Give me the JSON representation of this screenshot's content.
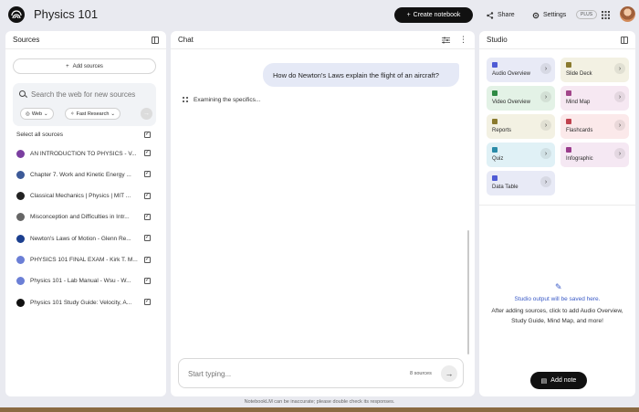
{
  "app": {
    "title": "Physics 101",
    "create_label": "Create notebook",
    "share_label": "Share",
    "settings_label": "Settings",
    "plus_badge": "PLUS"
  },
  "sources": {
    "title": "Sources",
    "add_label": "Add sources",
    "search_placeholder": "Search the web for new sources",
    "chip_web": "Web",
    "chip_fast": "Fast Research",
    "select_all": "Select all sources",
    "items": [
      {
        "label": "AN INTRODUCTION TO PHYSICS - V...",
        "icon": "doc-icon",
        "color": "#7b3fa0"
      },
      {
        "label": "Chapter 7. Work and Kinetic Energy ...",
        "icon": "pdf-icon",
        "color": "#3d5a98"
      },
      {
        "label": "Classical Mechanics | Physics | MIT ...",
        "icon": "mit-icon",
        "color": "#222222"
      },
      {
        "label": "Misconception and Difficulties in Intr...",
        "icon": "pdf-icon",
        "color": "#666666"
      },
      {
        "label": "Newton's Laws of Motion - Glenn Re...",
        "icon": "nasa-icon",
        "color": "#1b3f8f"
      },
      {
        "label": "PHYSICS 101 FINAL EXAM - Kirk T. M...",
        "icon": "web-icon",
        "color": "#6b7fd6"
      },
      {
        "label": "Physics 101 - Lab Manual - Wsu - W...",
        "icon": "web-icon",
        "color": "#6b7fd6"
      },
      {
        "label": "Physics 101 Study Guide: Velocity, A...",
        "icon": "p-icon",
        "color": "#111111"
      }
    ]
  },
  "chat": {
    "title": "Chat",
    "user_message": "How do Newton's Laws explain the flight of an aircraft?",
    "status": "Examining the specifics...",
    "input_placeholder": "Start typing...",
    "source_count": "8 sources"
  },
  "studio": {
    "title": "Studio",
    "tiles": [
      {
        "label": "Audio Overview",
        "bg": "#e8eaf6",
        "icon_color": "#4f5bd5"
      },
      {
        "label": "Slide Deck",
        "bg": "#f3f1e3",
        "icon_color": "#8a7a2e"
      },
      {
        "label": "Video Overview",
        "bg": "#e3f2e6",
        "icon_color": "#2f8a45"
      },
      {
        "label": "Mind Map",
        "bg": "#f6e8f2",
        "icon_color": "#a2458a"
      },
      {
        "label": "Reports",
        "bg": "#f3f1e3",
        "icon_color": "#8a7a2e"
      },
      {
        "label": "Flashcards",
        "bg": "#fbe9ea",
        "icon_color": "#c0424e"
      },
      {
        "label": "Quiz",
        "bg": "#e0f1f6",
        "icon_color": "#2a8ba8"
      },
      {
        "label": "Infographic",
        "bg": "#f5e8f3",
        "icon_color": "#9a3c8c"
      },
      {
        "label": "Data Table",
        "bg": "#e8eaf6",
        "icon_color": "#4f5bd5"
      }
    ],
    "empty_title": "Studio output will be saved here.",
    "empty_desc": "After adding sources, click to add Audio Overview, Study Guide, Mind Map, and more!",
    "add_note": "Add note"
  },
  "footer": "NotebookLM can be inaccurate; please double check its responses."
}
